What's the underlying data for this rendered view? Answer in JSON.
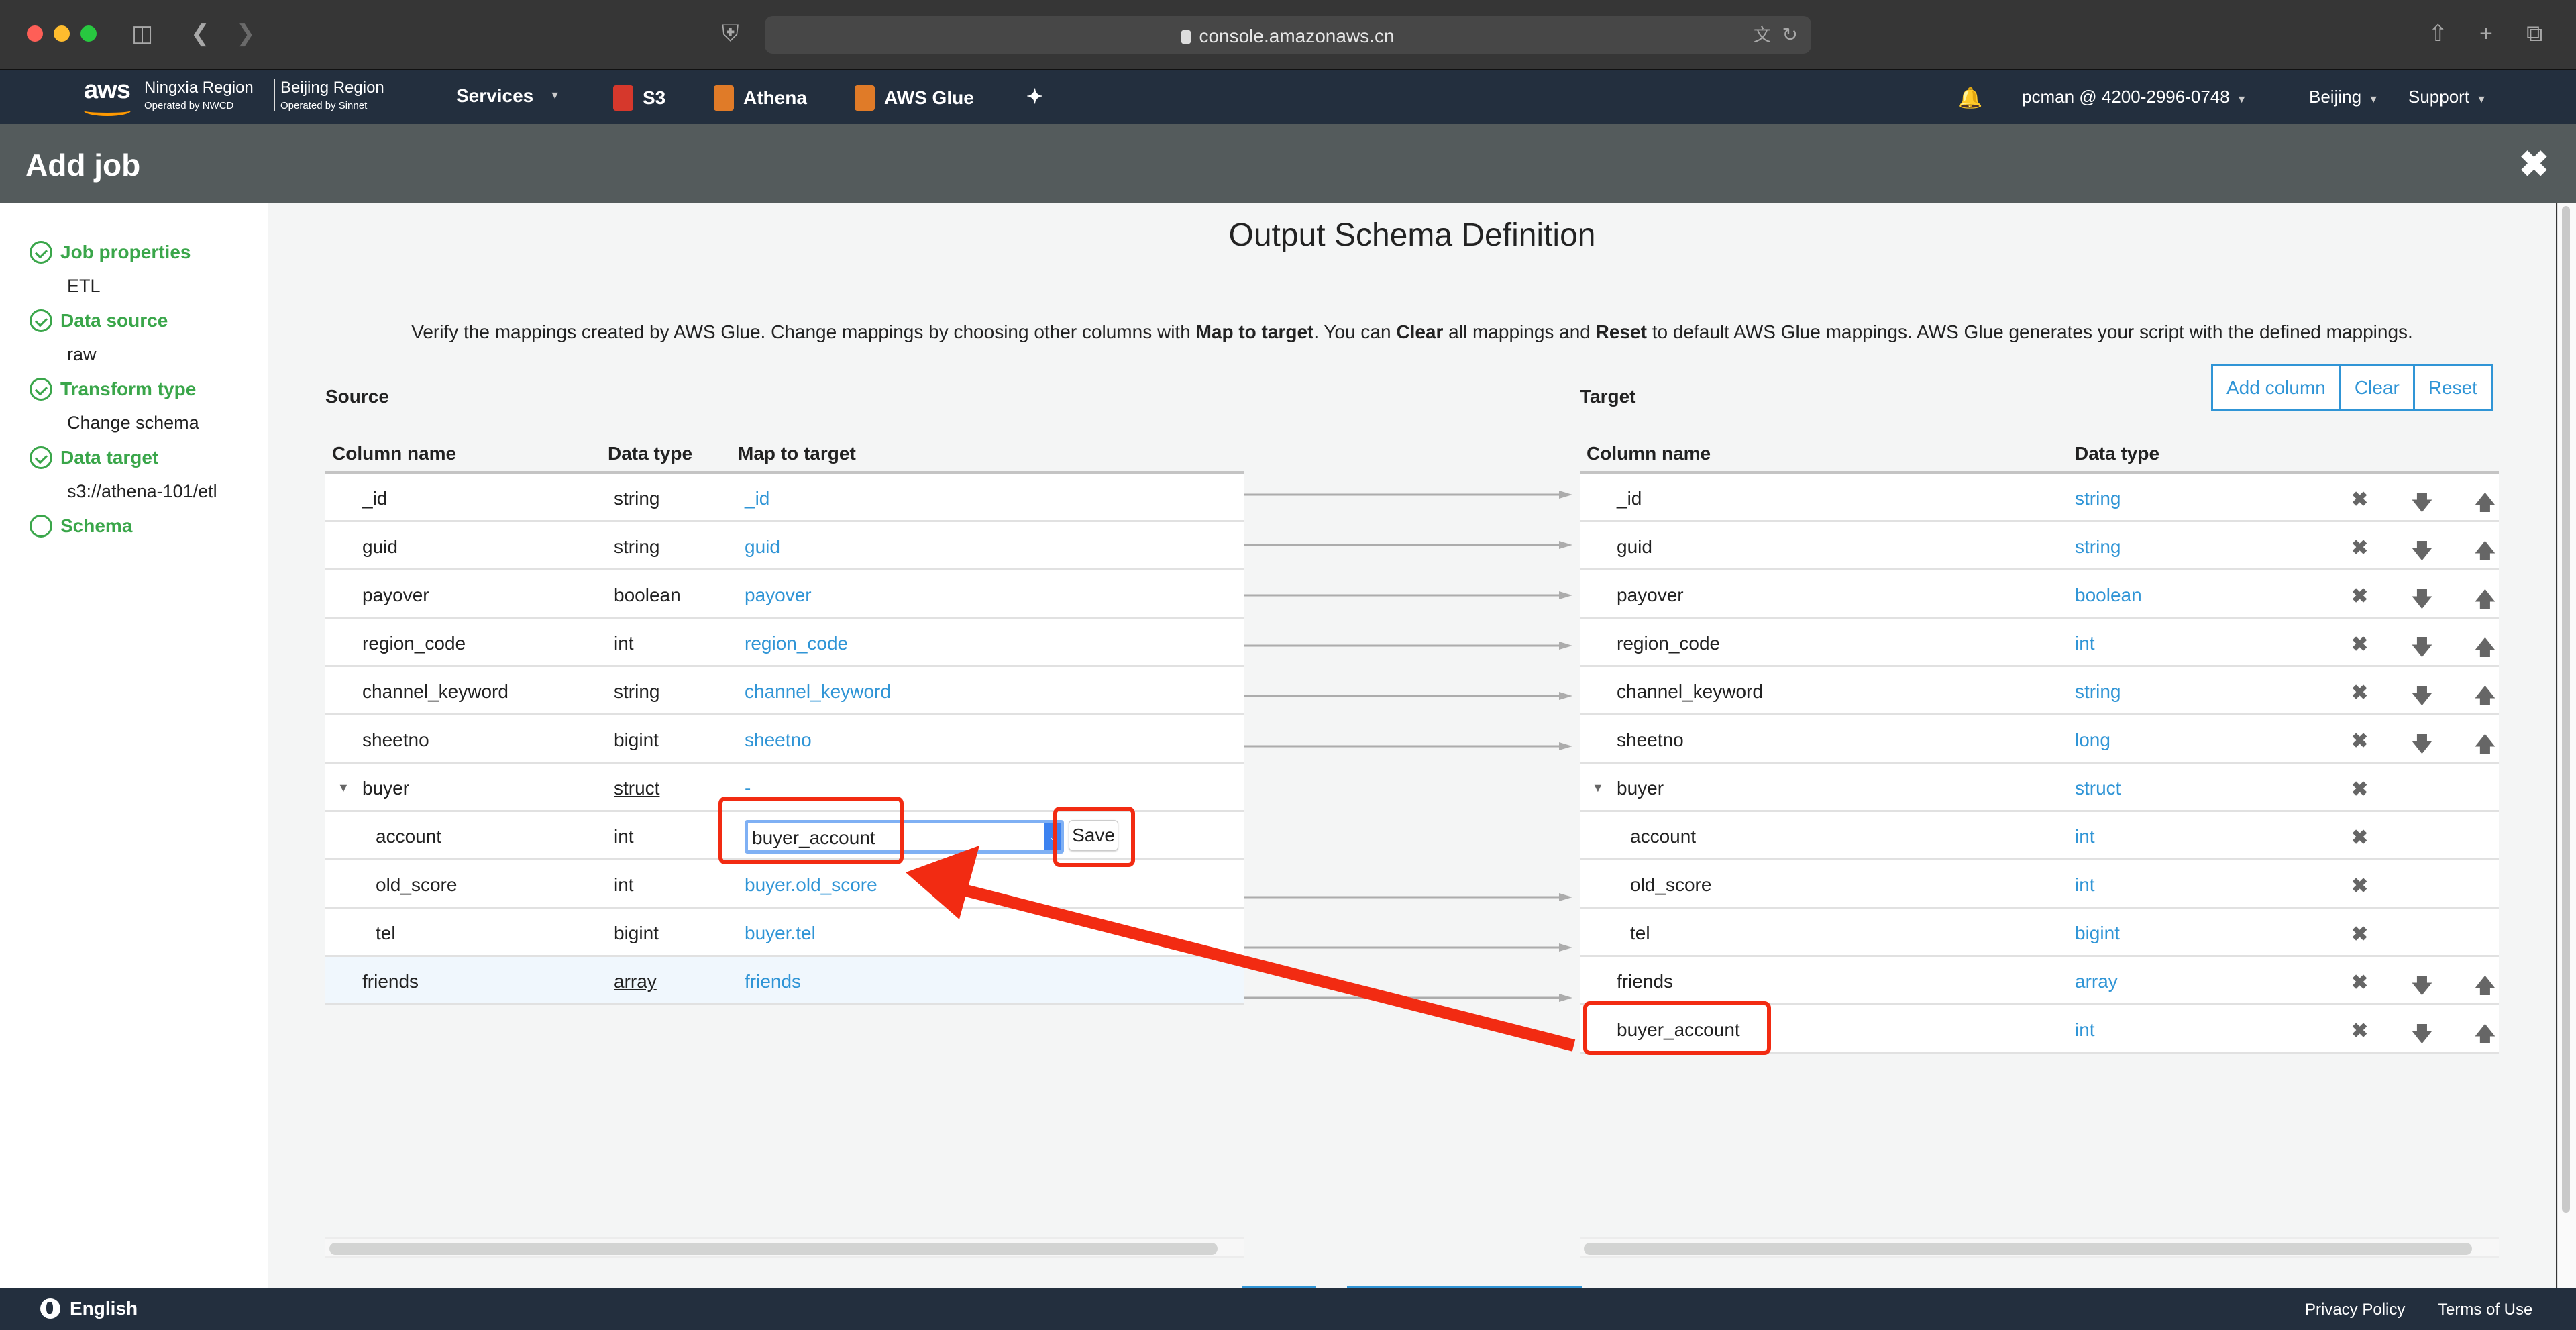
{
  "browser": {
    "url": "console.amazonaws.cn"
  },
  "nav": {
    "logo": "aws",
    "regions": [
      {
        "name": "Ningxia Region",
        "operator": "Operated by NWCD"
      },
      {
        "name": "Beijing Region",
        "operator": "Operated by Sinnet"
      }
    ],
    "services_label": "Services",
    "shortcuts": [
      {
        "label": "S3",
        "icon": "s3-icon",
        "color": "#d6382c"
      },
      {
        "label": "Athena",
        "icon": "athena-icon",
        "color": "#e07b28"
      },
      {
        "label": "AWS Glue",
        "icon": "glue-icon",
        "color": "#e07b28"
      }
    ],
    "account": "pcman @ 4200-2996-0748",
    "region": "Beijing",
    "support": "Support"
  },
  "header": {
    "title": "Add job",
    "close_icon": "close-icon"
  },
  "sidebar": {
    "steps": [
      {
        "label": "Job properties",
        "value": "ETL",
        "status": "done"
      },
      {
        "label": "Data source",
        "value": "raw",
        "status": "done"
      },
      {
        "label": "Transform type",
        "value": "Change schema",
        "status": "done"
      },
      {
        "label": "Data target",
        "value": "s3://athena-101/etl",
        "status": "done"
      },
      {
        "label": "Schema",
        "value": "",
        "status": "current"
      }
    ]
  },
  "main": {
    "title": "Output Schema Definition",
    "description": {
      "p1": "Verify the mappings created by AWS Glue. Change mappings by choosing other columns with ",
      "b1": "Map to target",
      "p2": ". You can ",
      "b2": "Clear",
      "p3": " all mappings and ",
      "b3": "Reset",
      "p4": " to default AWS Glue mappings. AWS Glue generates your script with the defined mappings."
    },
    "source": {
      "label": "Source",
      "headers": [
        "Column name",
        "Data type",
        "Map to target"
      ],
      "rows": [
        {
          "name": "_id",
          "type": "string",
          "map": "_id"
        },
        {
          "name": "guid",
          "type": "string",
          "map": "guid"
        },
        {
          "name": "payover",
          "type": "boolean",
          "map": "payover"
        },
        {
          "name": "region_code",
          "type": "int",
          "map": "region_code"
        },
        {
          "name": "channel_keyword",
          "type": "string",
          "map": "channel_keyword"
        },
        {
          "name": "sheetno",
          "type": "bigint",
          "map": "sheetno"
        },
        {
          "name": "buyer",
          "type": "struct",
          "map": "-"
        },
        {
          "name": "account",
          "type": "int",
          "map": "buyer_account"
        },
        {
          "name": "old_score",
          "type": "int",
          "map": "buyer.old_score"
        },
        {
          "name": "tel",
          "type": "bigint",
          "map": "buyer.tel"
        },
        {
          "name": "friends",
          "type": "array",
          "map": "friends"
        }
      ],
      "edit_select_value": "buyer_account",
      "save_label": "Save"
    },
    "target": {
      "label": "Target",
      "buttons": [
        "Add column",
        "Clear",
        "Reset"
      ],
      "headers": [
        "Column name",
        "Data type"
      ],
      "rows": [
        {
          "name": "_id",
          "type": "string"
        },
        {
          "name": "guid",
          "type": "string"
        },
        {
          "name": "payover",
          "type": "boolean"
        },
        {
          "name": "region_code",
          "type": "int"
        },
        {
          "name": "channel_keyword",
          "type": "string"
        },
        {
          "name": "sheetno",
          "type": "long"
        },
        {
          "name": "buyer",
          "type": "struct"
        },
        {
          "name": "account",
          "type": "int"
        },
        {
          "name": "old_score",
          "type": "int"
        },
        {
          "name": "tel",
          "type": "bigint"
        },
        {
          "name": "friends",
          "type": "array"
        },
        {
          "name": "buyer_account",
          "type": "int"
        }
      ]
    }
  },
  "footer": {
    "language": "English",
    "privacy": "Privacy Policy",
    "terms": "Terms of Use"
  },
  "colors": {
    "accent": "#3095d6",
    "success": "#3aa64a",
    "annotation": "#f22b12",
    "nav_bg": "#232f3e"
  }
}
